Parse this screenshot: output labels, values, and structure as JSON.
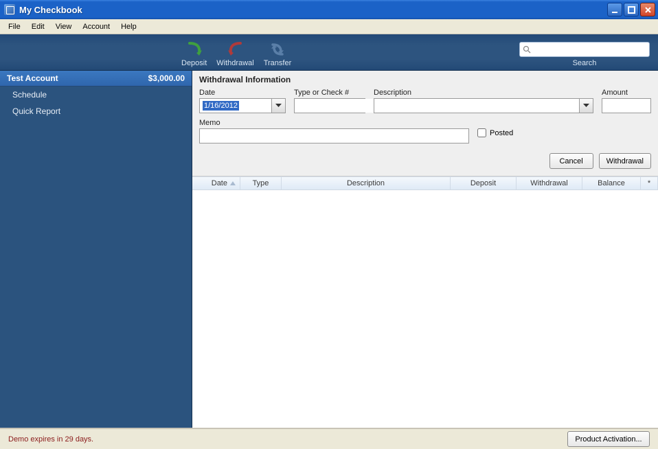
{
  "window": {
    "title": "My Checkbook"
  },
  "menu": {
    "items": [
      "File",
      "Edit",
      "View",
      "Account",
      "Help"
    ]
  },
  "toolbar": {
    "actions": [
      {
        "name": "deposit",
        "label": "Deposit",
        "color": "#3fa03f"
      },
      {
        "name": "withdrawal",
        "label": "Withdrawal",
        "color": "#b03a3a"
      },
      {
        "name": "transfer",
        "label": "Transfer",
        "color": "#5a7fa8"
      }
    ],
    "search_label": "Search",
    "search_placeholder": ""
  },
  "sidebar": {
    "account": {
      "name": "Test Account",
      "balance": "$3,000.00"
    },
    "items": [
      {
        "label": "Schedule"
      },
      {
        "label": "Quick Report"
      }
    ]
  },
  "panel": {
    "title": "Withdrawal Information",
    "labels": {
      "date": "Date",
      "type": "Type or Check #",
      "description": "Description",
      "amount": "Amount",
      "memo": "Memo",
      "posted": "Posted"
    },
    "values": {
      "date": "1/16/2012",
      "type": "",
      "description": "",
      "amount": "",
      "memo": "",
      "posted": false
    },
    "buttons": {
      "cancel": "Cancel",
      "submit": "Withdrawal"
    }
  },
  "table": {
    "columns": [
      "Date",
      "Type",
      "Description",
      "Deposit",
      "Withdrawal",
      "Balance",
      "*"
    ],
    "rows": []
  },
  "status": {
    "message": "Demo expires in 29 days.",
    "activation_button": "Product Activation..."
  }
}
